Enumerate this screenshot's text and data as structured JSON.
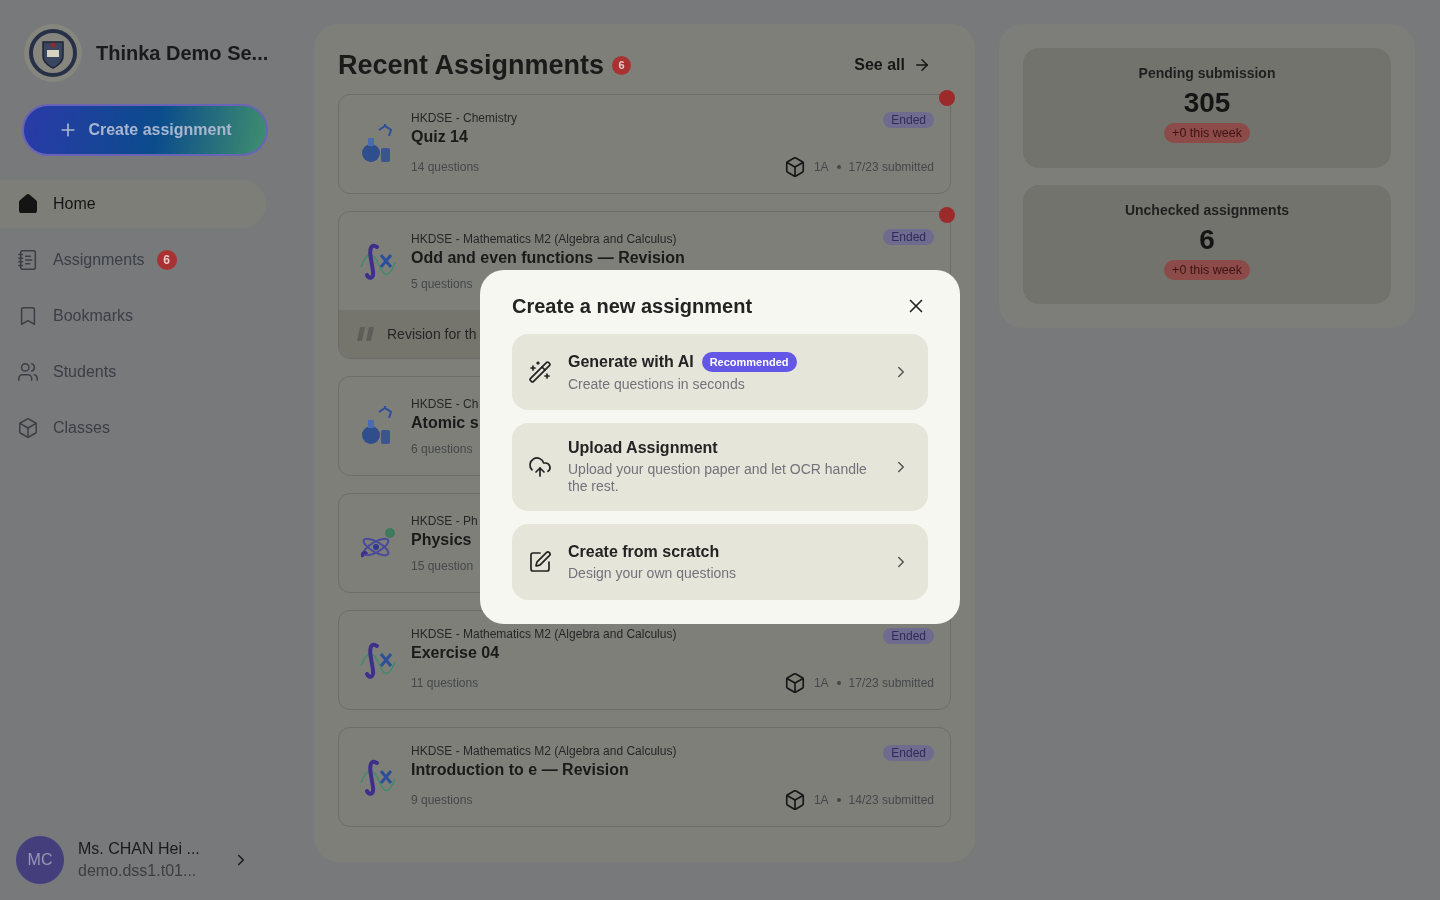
{
  "sidebar": {
    "school_name": "Thinka Demo Se...",
    "create_button": "Create assignment",
    "nav": [
      {
        "kind": "home",
        "label": "Home",
        "selected": true
      },
      {
        "kind": "assignments",
        "label": "Assignments",
        "badge": "6",
        "selected": false
      },
      {
        "kind": "bookmarks",
        "label": "Bookmarks",
        "selected": false
      },
      {
        "kind": "students",
        "label": "Students",
        "selected": false
      },
      {
        "kind": "classes",
        "label": "Classes",
        "selected": false
      }
    ],
    "user": {
      "initials": "MC",
      "name": "Ms. CHAN Hei ...",
      "email": "demo.dss1.t01..."
    }
  },
  "recent": {
    "title": "Recent Assignments",
    "count": "6",
    "see_all": "See all",
    "items": [
      {
        "kind": "chemistry",
        "subject": "HKDSE - Chemistry",
        "title": "Quiz 14",
        "questions": "14 questions",
        "status": "Ended",
        "class": "1A",
        "submitted": "17/23 submitted",
        "unread": true
      },
      {
        "kind": "math",
        "subject": "HKDSE - Mathematics M2 (Algebra and Calculus)",
        "title": "Odd and even functions — Revision",
        "questions": "5 questions",
        "status": "Ended",
        "note": "Revision for th",
        "unread": true
      },
      {
        "kind": "chemistry",
        "subject": "HKDSE - Ch",
        "title": "Atomic s",
        "questions": "6 questions",
        "unread": false
      },
      {
        "kind": "physics",
        "subject": "HKDSE - Ph",
        "title": "Physics",
        "questions": "15 question",
        "unread": false
      },
      {
        "kind": "math",
        "subject": "HKDSE - Mathematics M2 (Algebra and Calculus)",
        "title": "Exercise 04",
        "questions": "11 questions",
        "status": "Ended",
        "class": "1A",
        "submitted": "17/23 submitted",
        "unread": false
      },
      {
        "kind": "math",
        "subject": "HKDSE - Mathematics M2 (Algebra and Calculus)",
        "title": "Introduction to e — Revision",
        "questions": "9 questions",
        "status": "Ended",
        "class": "1A",
        "submitted": "14/23 submitted",
        "unread": false
      }
    ]
  },
  "stats": [
    {
      "label": "Pending submission",
      "value": "305",
      "change": "+0 this week"
    },
    {
      "label": "Unchecked assignments",
      "value": "6",
      "change": "+0 this week"
    }
  ],
  "modal": {
    "title": "Create a new assignment",
    "options": [
      {
        "kind": "ai",
        "title": "Generate with AI",
        "tag": "Recommended",
        "subtitle": "Create questions in seconds"
      },
      {
        "kind": "upload",
        "title": "Upload Assignment",
        "subtitle": "Upload your question paper and let OCR handle the rest."
      },
      {
        "kind": "scratch",
        "title": "Create from scratch",
        "subtitle": "Design your own questions"
      }
    ]
  }
}
